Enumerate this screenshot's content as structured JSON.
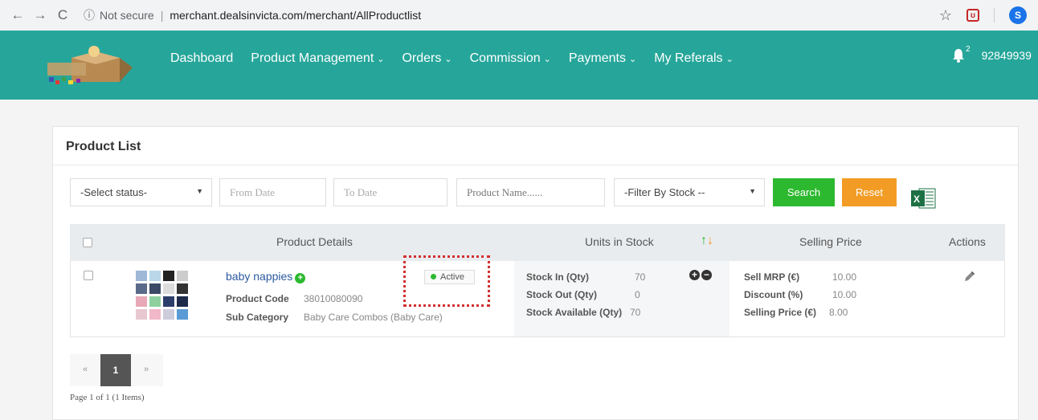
{
  "browser": {
    "security": "Not secure",
    "url": "merchant.dealsinvicta.com/merchant/AllProductlist",
    "profile_initial": "S"
  },
  "nav": {
    "items": [
      {
        "label": "Dashboard"
      },
      {
        "label": "Product Management"
      },
      {
        "label": "Orders"
      },
      {
        "label": "Commission"
      },
      {
        "label": "Payments"
      },
      {
        "label": "My Referals"
      }
    ],
    "notification_count": "2",
    "user": "92849939"
  },
  "panel": {
    "title": "Product List"
  },
  "filters": {
    "status": "-Select status-",
    "from_date": "From Date",
    "to_date": "To Date",
    "product_name": "Product Name......",
    "stock": "-Filter By Stock --",
    "search": "Search",
    "reset": "Reset"
  },
  "table": {
    "headers": {
      "details": "Product Details",
      "stock": "Units in Stock",
      "price": "Selling Price",
      "actions": "Actions"
    },
    "row": {
      "name": "baby nappies",
      "status": "Active",
      "code_label": "Product Code",
      "code": "38010080090",
      "subcat_label": "Sub Category",
      "subcat": "Baby Care Combos (Baby Care)",
      "stock_in_label": "Stock In (Qty)",
      "stock_in": "70",
      "stock_out_label": "Stock Out (Qty)",
      "stock_out": "0",
      "stock_avail_label": "Stock Available (Qty)",
      "stock_avail": "70",
      "mrp_label": "Sell MRP (€)",
      "mrp": "10.00",
      "discount_label": "Discount (%)",
      "discount": "10.00",
      "price_label": "Selling Price (€)",
      "price": "8.00"
    }
  },
  "pagination": {
    "prev": "«",
    "current": "1",
    "next": "»",
    "info": "Page 1 of 1 (1 Items)"
  },
  "colors": {
    "header": "#26a69a",
    "search": "#2db92f",
    "reset": "#f39c25",
    "highlight": "#d32f2f"
  }
}
